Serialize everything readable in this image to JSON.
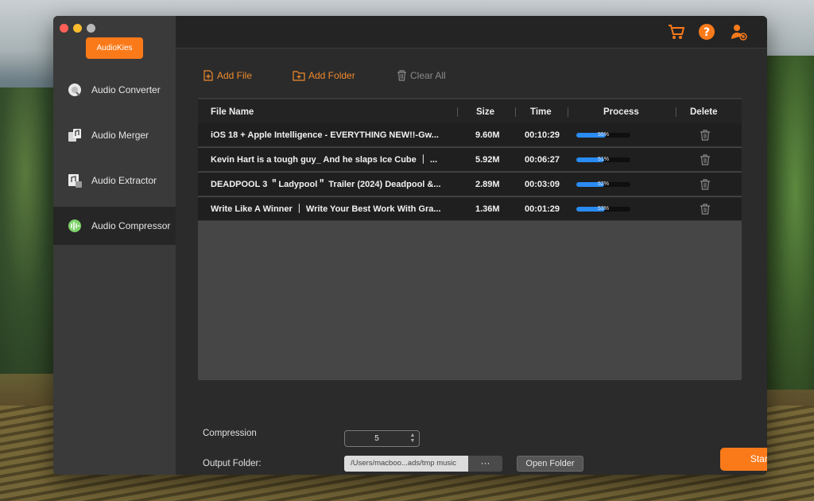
{
  "app": {
    "brand": "AudioKies"
  },
  "sidebar": {
    "items": [
      {
        "label": "Audio Converter",
        "icon": "audio-converter-icon",
        "active": false
      },
      {
        "label": "Audio Merger",
        "icon": "audio-merger-icon",
        "active": false
      },
      {
        "label": "Audio Extractor",
        "icon": "audio-extractor-icon",
        "active": false
      },
      {
        "label": "Audio Compressor",
        "icon": "audio-compressor-icon",
        "active": true
      }
    ]
  },
  "header": {
    "icons": [
      "cart-icon",
      "help-icon",
      "account-icon"
    ],
    "accent": "#fa7a1a"
  },
  "toolbar": {
    "add_file": "Add File",
    "add_folder": "Add Folder",
    "clear_all": "Clear All"
  },
  "table": {
    "columns": [
      "File Name",
      "Size",
      "Time",
      "Process",
      "Delete"
    ],
    "rows": [
      {
        "name": "iOS 18 + Apple Intelligence - EVERYTHING NEW!!-Gw...",
        "size": "9.60M",
        "time": "00:10:29",
        "progress": 55,
        "progress_label": "55%"
      },
      {
        "name": "Kevin Hart is a tough guy_ And he slaps Ice Cube ｜ ...",
        "size": "5.92M",
        "time": "00:06:27",
        "progress": 51,
        "progress_label": "51%"
      },
      {
        "name": "DEADPOOL 3 ＂Ladypool＂ Trailer (2024) Deadpool &...",
        "size": "2.89M",
        "time": "00:03:09",
        "progress": 52,
        "progress_label": "52%"
      },
      {
        "name": "Write Like A Winner ｜ Write Your Best Work With Gra...",
        "size": "1.36M",
        "time": "00:01:29",
        "progress": 53,
        "progress_label": "53%"
      }
    ]
  },
  "settings": {
    "compression_label": "Compression",
    "compression_value": "5",
    "output_label": "Output Folder:",
    "output_path": "/Users/macboo...ads/tmp music",
    "browse_label": "···",
    "open_folder": "Open Folder",
    "start": "Start"
  }
}
